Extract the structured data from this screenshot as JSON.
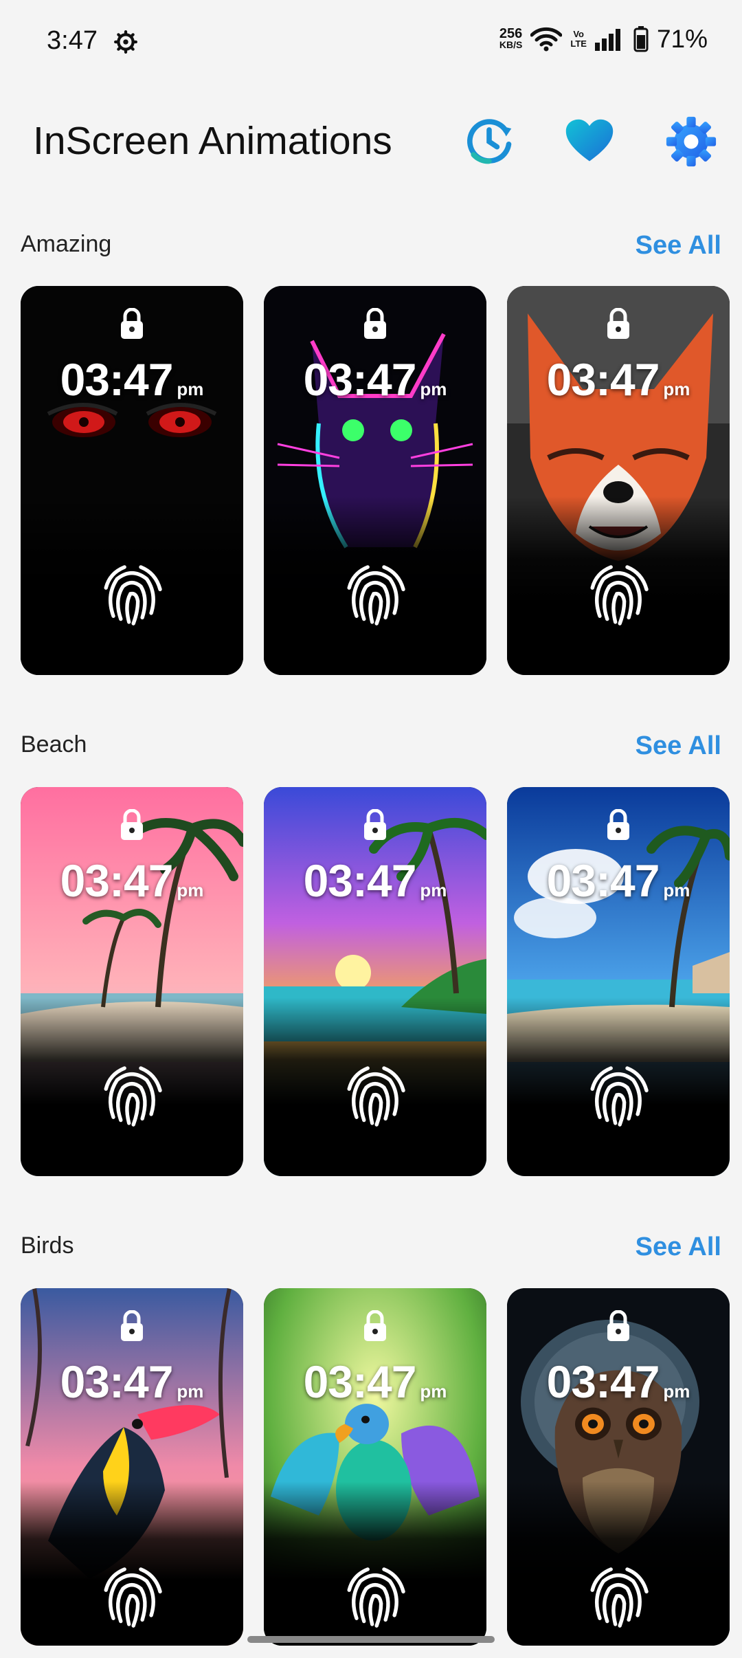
{
  "status_bar": {
    "time": "3:47",
    "net_speed_value": "256",
    "net_speed_unit": "KB/S",
    "volte_top": "Vo",
    "volte_bottom": "LTE",
    "battery": "71%"
  },
  "header": {
    "title": "InScreen Animations",
    "icons": [
      "history-icon",
      "favorite-heart-icon",
      "settings-gear-icon"
    ]
  },
  "sections": [
    {
      "title": "Amazing",
      "see_all": "See All",
      "cards": [
        {
          "time": "03:47",
          "ampm": "pm",
          "theme": "red eyes"
        },
        {
          "time": "03:47",
          "ampm": "pm",
          "theme": "neon cat"
        },
        {
          "time": "03:47",
          "ampm": "pm",
          "theme": "fox"
        }
      ]
    },
    {
      "title": "Beach",
      "see_all": "See All",
      "cards": [
        {
          "time": "03:47",
          "ampm": "pm",
          "theme": "pink beach"
        },
        {
          "time": "03:47",
          "ampm": "pm",
          "theme": "sunset beach"
        },
        {
          "time": "03:47",
          "ampm": "pm",
          "theme": "blue beach"
        }
      ]
    },
    {
      "title": "Birds",
      "see_all": "See All",
      "cards": [
        {
          "time": "03:47",
          "ampm": "pm",
          "theme": "toucan"
        },
        {
          "time": "03:47",
          "ampm": "pm",
          "theme": "parrot"
        },
        {
          "time": "03:47",
          "ampm": "pm",
          "theme": "owl"
        }
      ]
    }
  ],
  "colors": {
    "accent": "#2f8fe0",
    "background": "#f4f4f4",
    "history_icon": "#1a8fd6",
    "heart_icon": "#1a9ad6",
    "gear_icon": "#2e7ff0"
  }
}
